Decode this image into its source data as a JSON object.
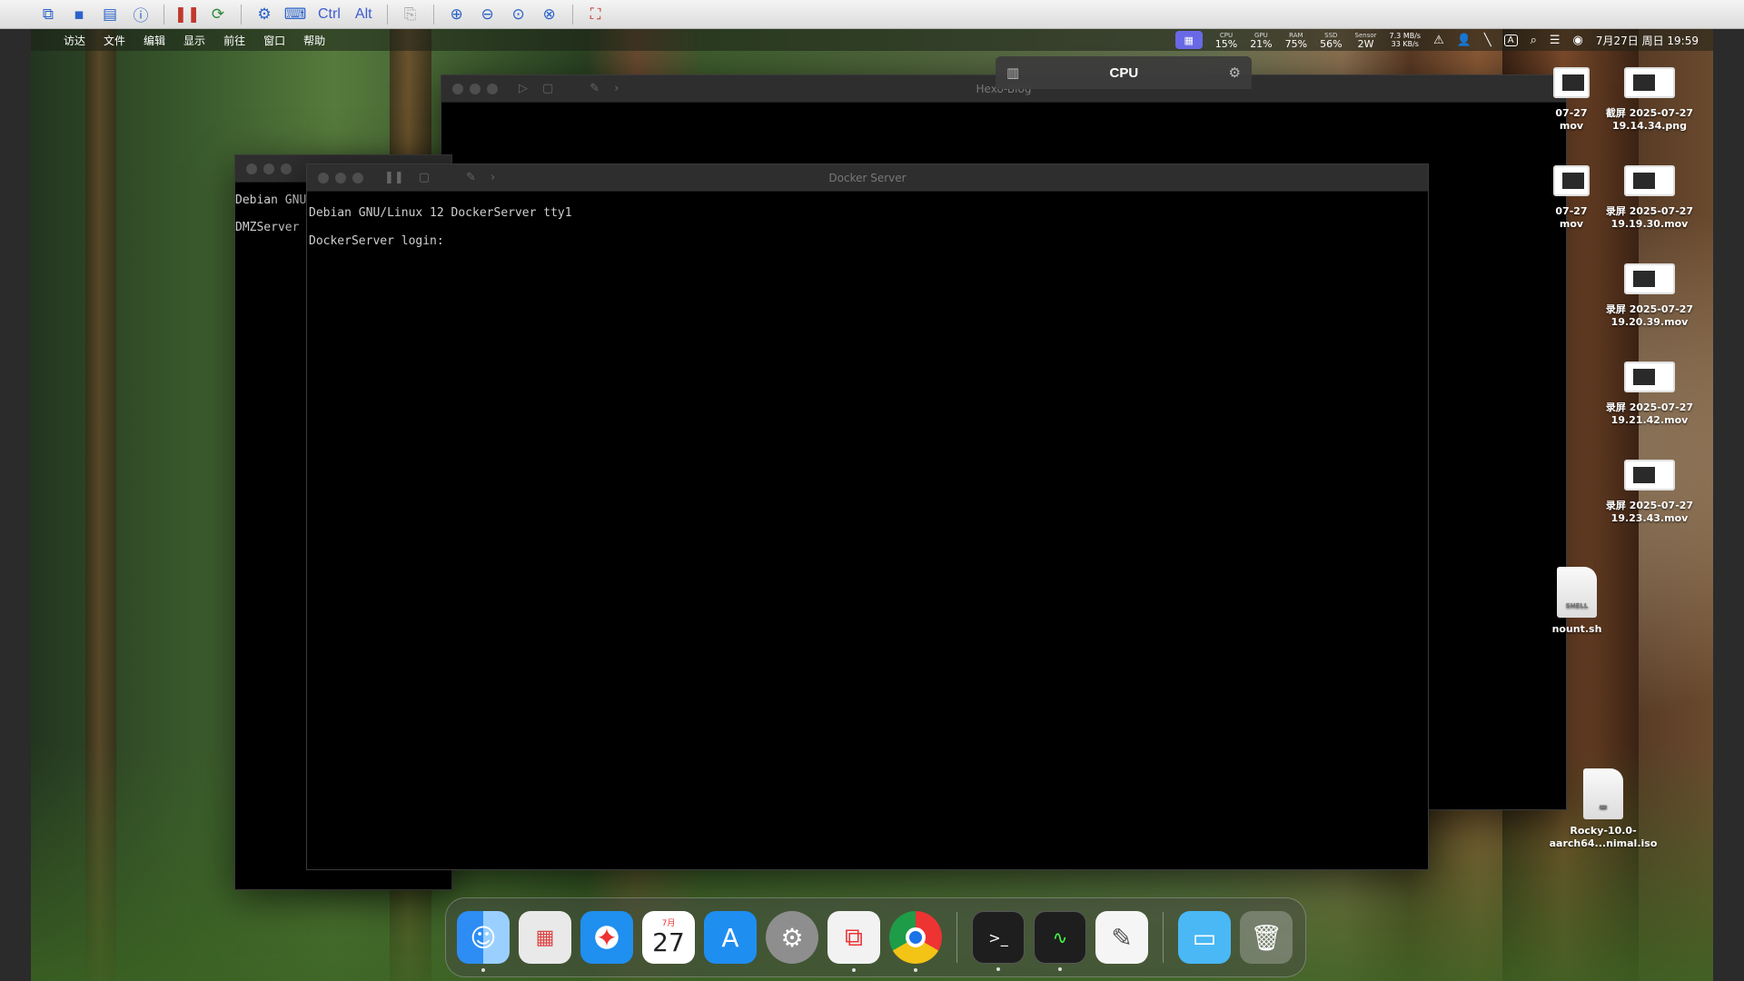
{
  "viewer_toolbar": {
    "ctrl_label": "Ctrl",
    "alt_label": "Alt"
  },
  "menubar": {
    "items": [
      "访达",
      "文件",
      "编辑",
      "显示",
      "前往",
      "窗口",
      "帮助"
    ],
    "stats": [
      {
        "label": "CPU",
        "value": "15%"
      },
      {
        "label": "GPU",
        "value": "21%"
      },
      {
        "label": "RAM",
        "value": "75%"
      },
      {
        "label": "SSD",
        "value": "56%"
      },
      {
        "label": "Sensor",
        "value": "2W"
      },
      {
        "label": "7.3 MB/s",
        "value": "33 KB/s"
      }
    ],
    "input_indicator": "A",
    "datetime": "7月27日 周日 19:59"
  },
  "cpu_popup": {
    "title": "CPU"
  },
  "windows": {
    "hexo": {
      "title": "Hexo-Blog"
    },
    "dmz": {
      "lines": [
        "Debian GNU",
        "DMZServer"
      ]
    },
    "docker": {
      "title": "Docker Server",
      "line1": "Debian GNU/Linux 12 DockerServer tty1",
      "line2": "DockerServer login:"
    }
  },
  "desktop": {
    "partial": [
      {
        "l1": "07-27",
        "l2": "mov"
      },
      {
        "l1": "07-27",
        "l2": "mov"
      }
    ],
    "files": [
      {
        "l1": "截屏 2025-07-27",
        "l2": "19.14.34.png"
      },
      {
        "l1": "录屏 2025-07-27",
        "l2": "19.19.30.mov"
      },
      {
        "l1": "录屏 2025-07-27",
        "l2": "19.20.39.mov"
      },
      {
        "l1": "录屏 2025-07-27",
        "l2": "19.21.42.mov"
      },
      {
        "l1": "录屏 2025-07-27",
        "l2": "19.23.43.mov"
      }
    ],
    "mount": {
      "label": "nount.sh",
      "tag": "SHELL"
    },
    "iso": {
      "l1": "Rocky-10.0-",
      "l2": "aarch64...nimal.iso"
    }
  },
  "dock": {
    "calendar_month": "7月",
    "calendar_day": "27"
  }
}
